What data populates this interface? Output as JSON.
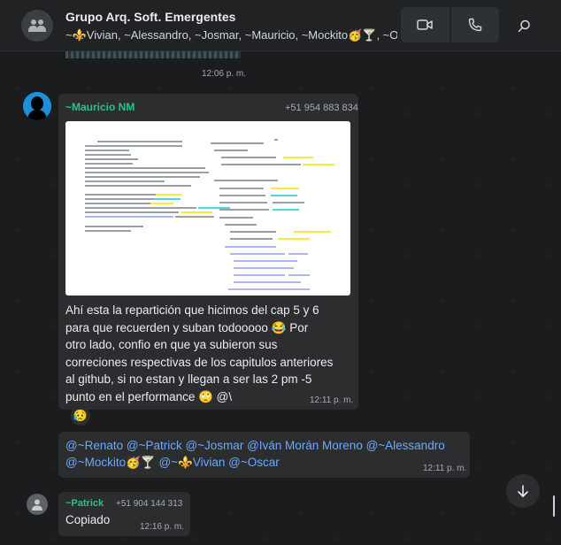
{
  "header": {
    "title": "Grupo Arq. Soft. Emergentes",
    "members": "~⚜️Vivian, ~Alessandro, ~Josmar, ~Mauricio, ~Mockito🥳🍸, ~Oscar, ~Patrick, ~Renato, Tú",
    "icons": [
      "group-avatar-icon",
      "video-call-icon",
      "voice-call-icon",
      "search-icon"
    ]
  },
  "prev_message": {
    "time": "12:06 p. m."
  },
  "message1": {
    "sender": "~Mauricio NM",
    "phone": "+51 954 883 834",
    "text_lines": [
      "Ahí esta la repartición que hicimos del cap 5 y 6",
      "para que recuerden y suban todooooo 😂 Por",
      "otro lado, confio en que ya subieron sus",
      "correciones respectivas de los capitulos anteriores",
      "al github, si no estan y llegan a ser las 2 pm -5",
      "punto en el performance 🙄 @\\"
    ],
    "time": "12:11 p. m.",
    "reaction": "😥"
  },
  "message2": {
    "line1": "@~Renato @~Patrick @~Josmar @Iván Morán Moreno @~Alessandro",
    "line2": "@~Mockito🥳🍸 @~⚜️Vivian @~Oscar",
    "time": "12:11 p. m."
  },
  "message3": {
    "sender": "~Patrick",
    "phone": "+51 904 144 313",
    "text": "Copiado",
    "time": "12:16 p. m."
  },
  "colors": {
    "background": "#1a1c1d",
    "bubble": "#2b2d2f",
    "sender_name": "#2fbf8f",
    "mention": "#6ea8fe"
  }
}
